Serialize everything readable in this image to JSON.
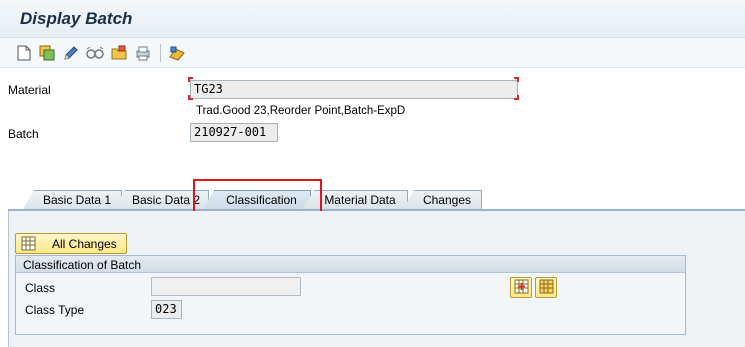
{
  "window": {
    "title": "Display Batch"
  },
  "toolbar": {
    "icons": [
      "new-document-icon",
      "other-object-icon",
      "edit-pencil-icon",
      "display-change-glasses-icon",
      "folder-icon",
      "print-icon",
      "settings-icon"
    ]
  },
  "header": {
    "material_label": "Material",
    "material_value": "TG23",
    "material_description": "Trad.Good 23,Reorder Point,Batch-ExpD",
    "batch_label": "Batch",
    "batch_value": "210927-001"
  },
  "tabs": [
    {
      "label": "Basic Data 1",
      "active": false
    },
    {
      "label": "Basic Data 2",
      "active": false
    },
    {
      "label": "Classification",
      "active": true
    },
    {
      "label": "Material Data",
      "active": false
    },
    {
      "label": "Changes",
      "active": false
    }
  ],
  "content": {
    "all_changes_label": "All Changes",
    "group_title": "Classification of Batch",
    "class_label": "Class",
    "class_value": "",
    "class_type_label": "Class Type",
    "class_type_value": "023"
  },
  "colors": {
    "highlight": "#e0141c",
    "button_yellow": "#fde98a",
    "title_text": "#1a2f45"
  }
}
